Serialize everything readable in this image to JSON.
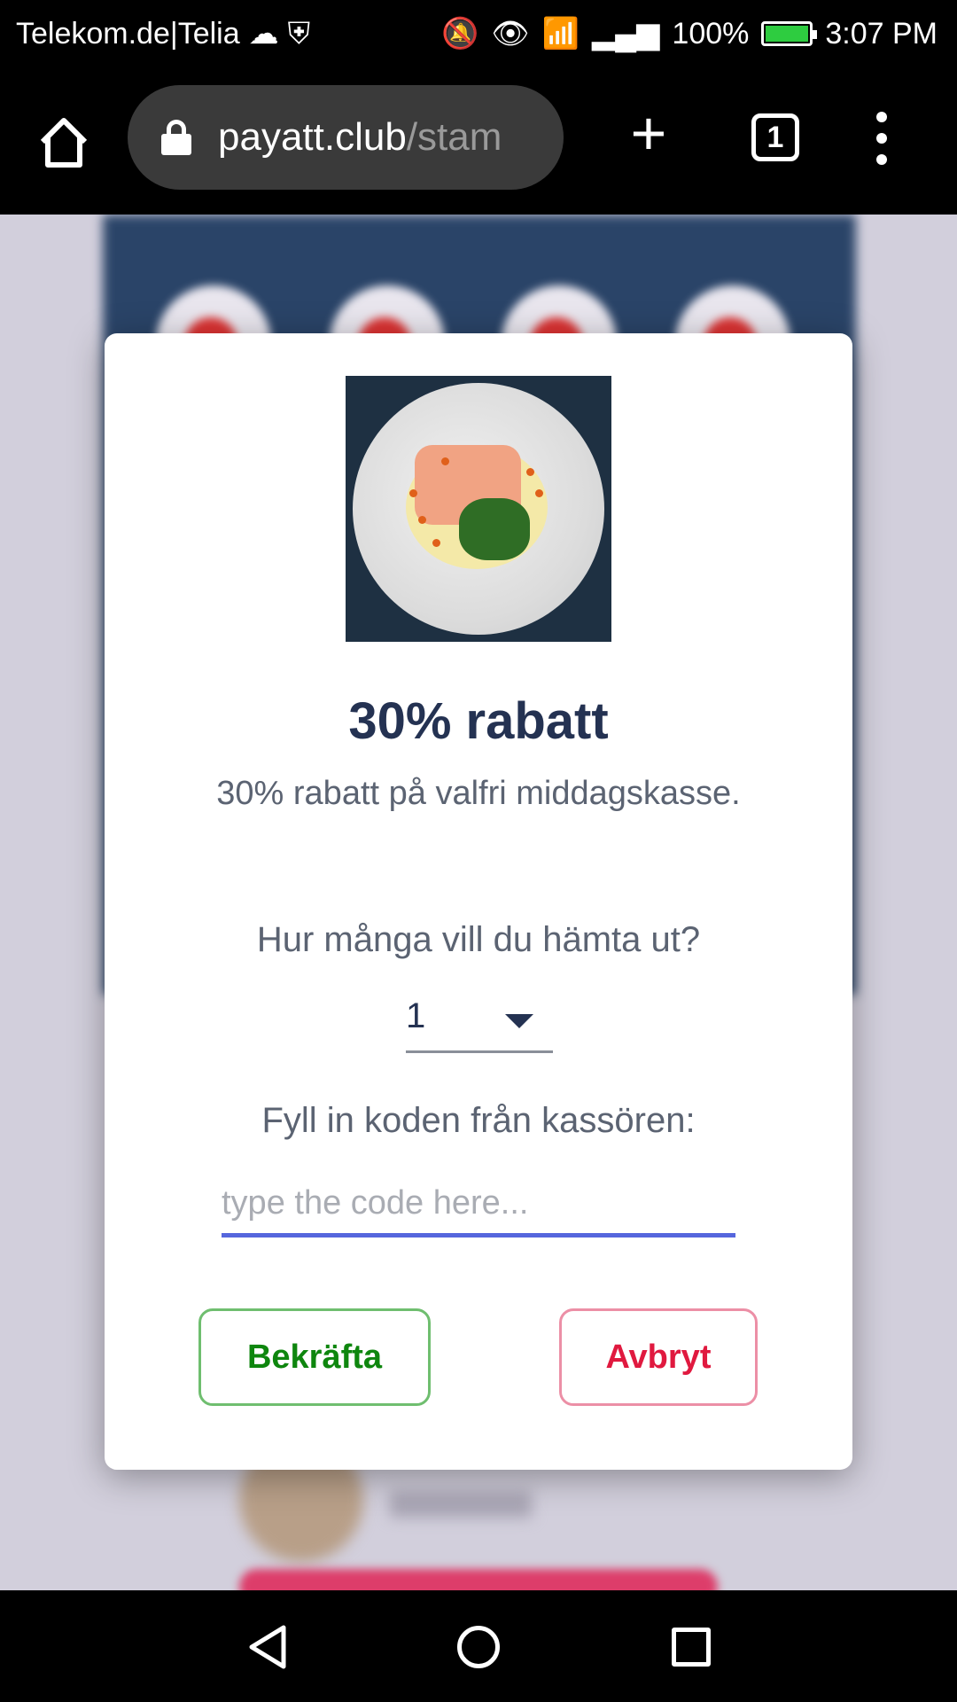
{
  "status_bar": {
    "carrier": "Telekom.de|Telia",
    "battery": "100%",
    "time": "3:07 PM"
  },
  "browser": {
    "url_host": "payatt.club",
    "url_path": "/stam",
    "tab_count": "1"
  },
  "modal": {
    "title": "30% rabatt",
    "description": "30% rabatt på valfri middagskasse.",
    "quantity_question": "Hur många vill du hämta ut?",
    "quantity_value": "1",
    "code_label": "Fyll in koden från kassören:",
    "code_placeholder": "type the code here...",
    "confirm_label": "Bekräfta",
    "cancel_label": "Avbryt"
  },
  "colors": {
    "title": "#243252",
    "confirm": "#0e860e",
    "cancel": "#e0193f",
    "input_underline": "#5566dd"
  }
}
